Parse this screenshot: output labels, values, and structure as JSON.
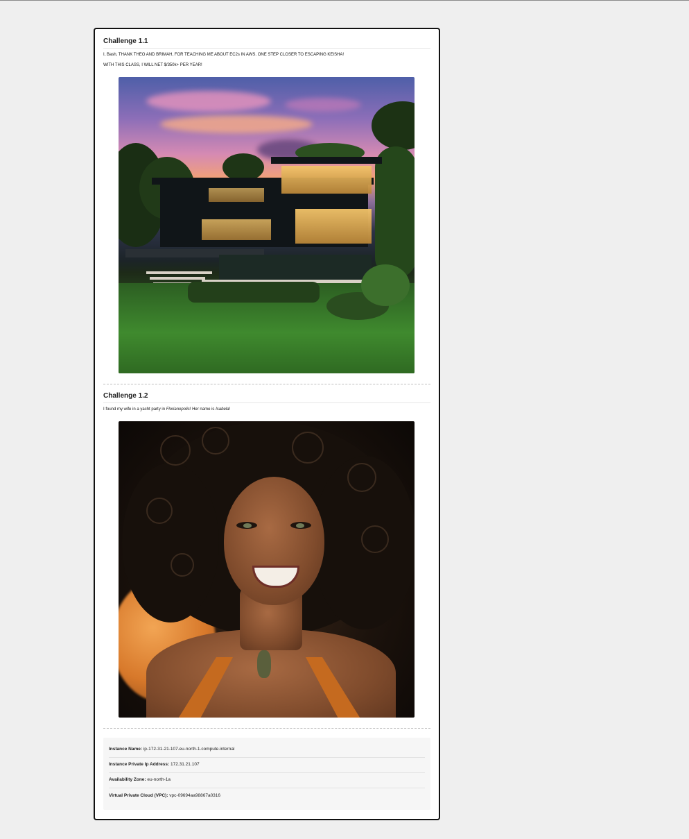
{
  "challenges": [
    {
      "title": "Challenge 1.1",
      "lines": [
        "I, Bash, THANK THEO AND BRIMAH, FOR TEACHING ME ABOUT EC2s IN AWS. ONE STEP CLOSER TO ESCAPING KEISHA!",
        "WITH THIS CLASS, I WILL NET $/350k+ PER YEAR!"
      ]
    },
    {
      "title": "Challenge 1.2",
      "sentence": {
        "before": "I found my wife in a yacht party in ",
        "place": "Florianopolis",
        "middle": "! Her name is ",
        "name": "Isabela",
        "after": "!"
      }
    }
  ],
  "instance": {
    "name_label": "Instance Name:",
    "name_value": "ip-172-31-21-107.eu-north-1.compute.internal",
    "ip_label": "Instance Private Ip Address:",
    "ip_value": "172.31.21.107",
    "az_label": "Availability Zone:",
    "az_value": "eu-north-1a",
    "vpc_label": "Virtual Private Cloud (VPC):",
    "vpc_value": "vpc-09694aa98867a0316"
  }
}
